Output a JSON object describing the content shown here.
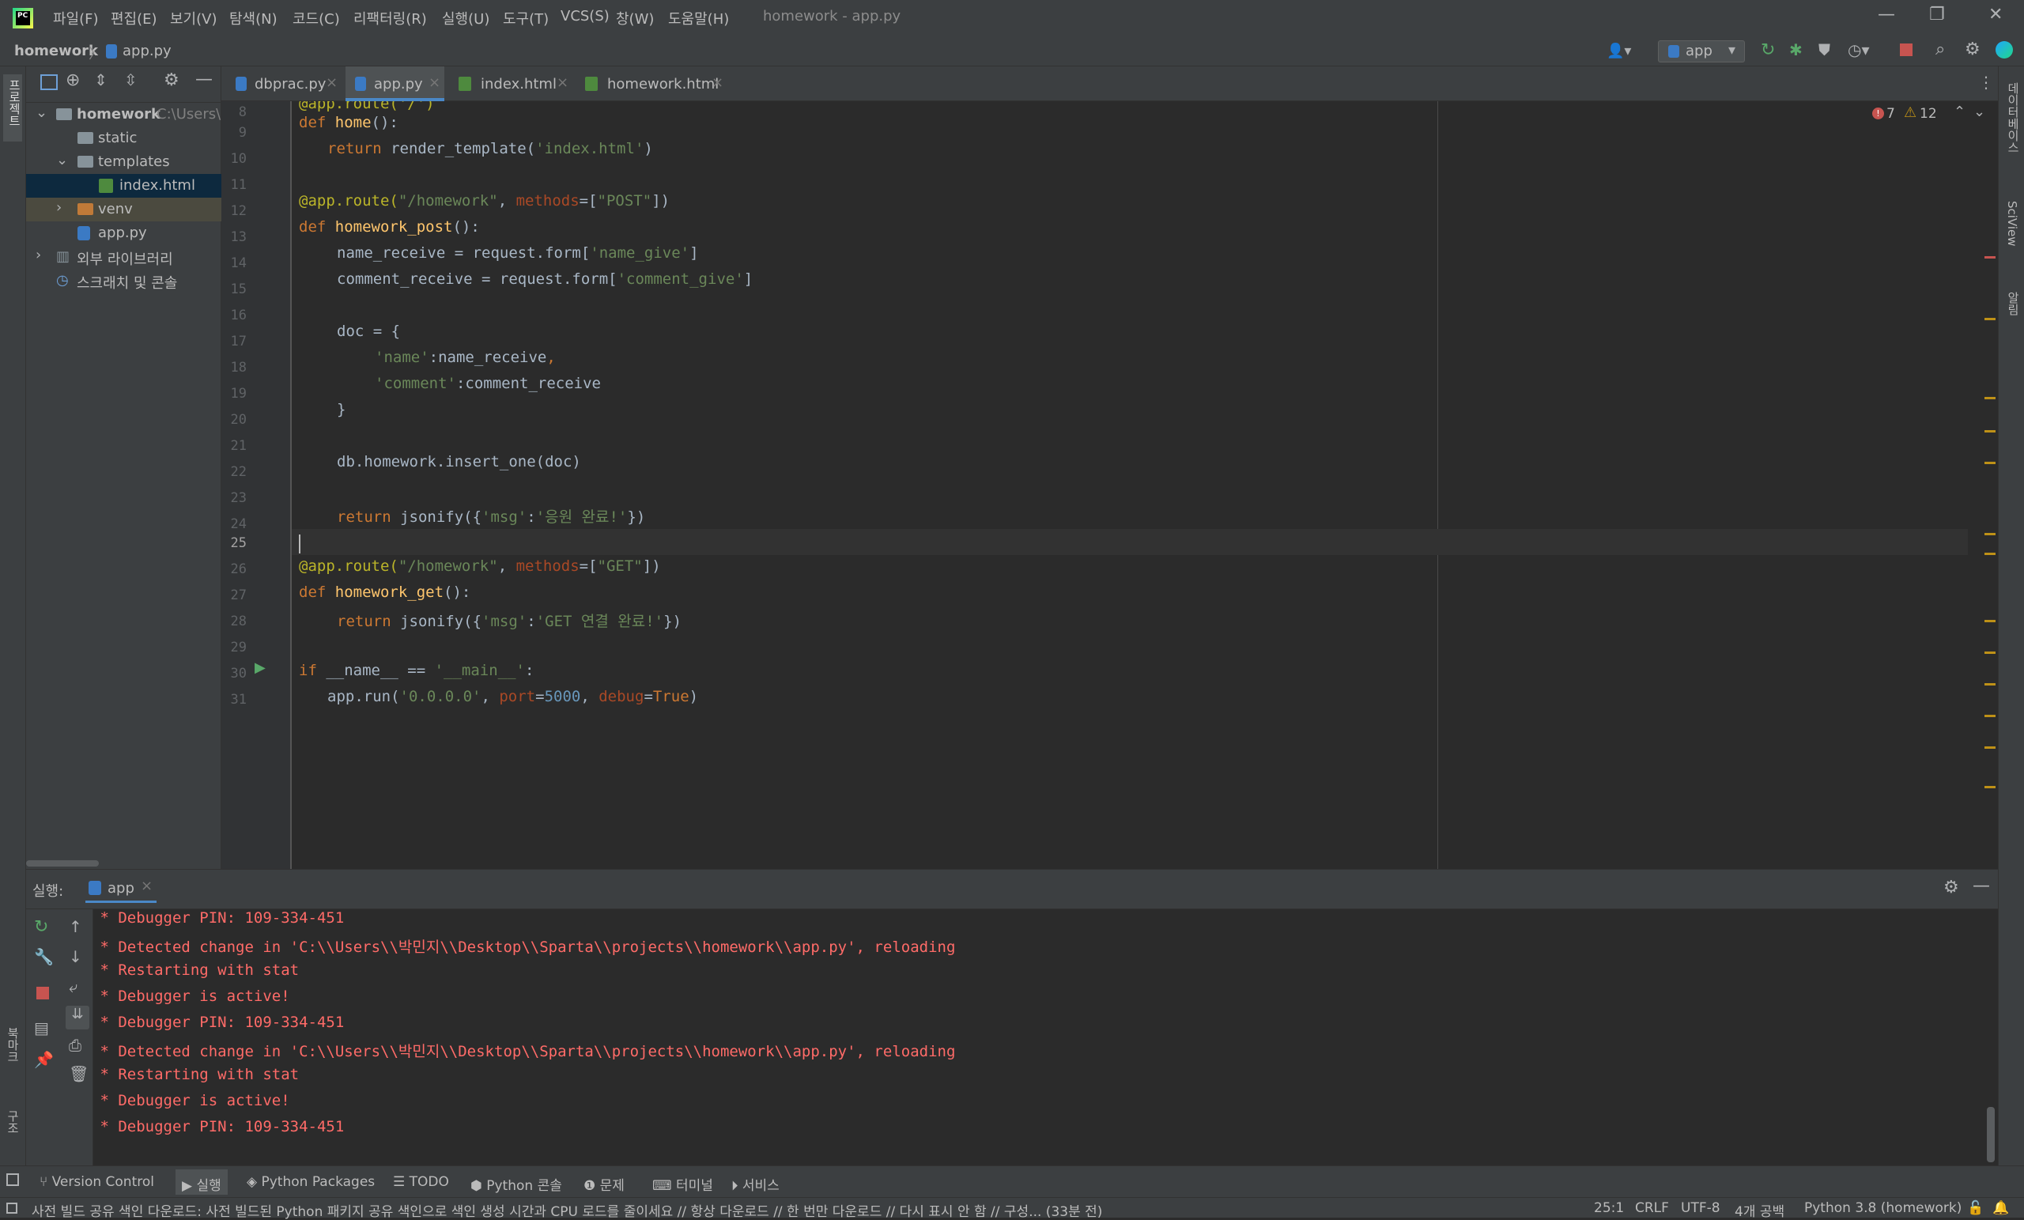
{
  "window": {
    "app_icon": "pycharm-logo",
    "menu": [
      "파일(F)",
      "편집(E)",
      "보기(V)",
      "탐색(N)",
      "코드(C)",
      "리팩터링(R)",
      "실행(U)",
      "도구(T)",
      "VCS(S)",
      "창(W)",
      "도움말(H)"
    ],
    "title": "homework - app.py"
  },
  "navbar": {
    "breadcrumb": [
      "homework",
      "app.py"
    ],
    "run_config": "app"
  },
  "left_strip": {
    "project_label": "프로젝트",
    "bookmarks_label": "북마크",
    "structure_label": "구조"
  },
  "right_strip": {
    "database_label": "데이터베이스",
    "sciview_label": "SciView",
    "notifications_label": "알림"
  },
  "project_tree": {
    "root": "homework",
    "root_path": "C:\\Users\\",
    "items": [
      "static",
      "templates",
      "index.html",
      "venv",
      "app.py",
      "외부 라이브러리",
      "스크래치 및 콘솔"
    ]
  },
  "editor": {
    "tabs": [
      "dbprac.py",
      "app.py",
      "index.html",
      "homework.html"
    ],
    "active_tab": "app.py",
    "errors": "7",
    "warnings": "12",
    "line_numbers": [
      "8",
      "9",
      "10",
      "11",
      "12",
      "13",
      "14",
      "15",
      "16",
      "17",
      "18",
      "19",
      "20",
      "21",
      "22",
      "23",
      "24",
      "25",
      "26",
      "27",
      "28",
      "29",
      "30",
      "31"
    ]
  },
  "run_panel": {
    "label": "실행:",
    "tab": "app",
    "console": [
      " * Debugger PIN: 109-334-451",
      " * Detected change in 'C:\\\\Users\\\\박민지\\\\Desktop\\\\Sparta\\\\projects\\\\homework\\\\app.py', reloading",
      " * Restarting with stat",
      " * Debugger is active!",
      " * Debugger PIN: 109-334-451",
      " * Detected change in 'C:\\\\Users\\\\박민지\\\\Desktop\\\\Sparta\\\\projects\\\\homework\\\\app.py', reloading",
      " * Restarting with stat",
      " * Debugger is active!",
      " * Debugger PIN: 109-334-451"
    ]
  },
  "toolwindows": [
    "Version Control",
    "실행",
    "Python Packages",
    "TODO",
    "Python 콘솔",
    "문제",
    "터미널",
    "서비스"
  ],
  "statusbar": {
    "message": "사전 빌드 공유 색인 다운로드: 사전 빌드된 Python 패키지 공유 색인으로 색인 생성 시간과 CPU 로드를 줄이세요 // 항상 다운로드 // 한 번만 다운로드 // 다시 표시 안 함 // 구성... (33분 전)",
    "position": "25:1",
    "line_sep": "CRLF",
    "encoding": "UTF-8",
    "indent": "4개 공백",
    "interpreter": "Python 3.8 (homework)"
  }
}
